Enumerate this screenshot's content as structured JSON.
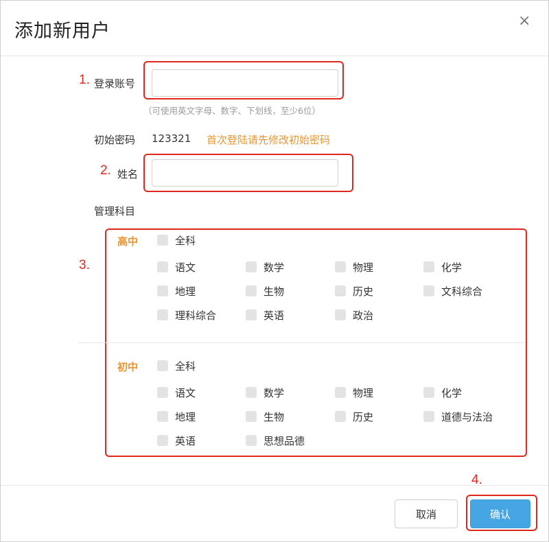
{
  "dialog": {
    "title": "添加新用户",
    "close_glyph": "×"
  },
  "annotations": [
    "1.",
    "2.",
    "3.",
    "4."
  ],
  "form": {
    "account_label": "登录账号",
    "account_value": "",
    "account_hint": "（可使用英文字母、数字、下划线，至少6位）",
    "password_label": "初始密码",
    "password_value": "123321",
    "password_warning": "首次登陆请先修改初始密码",
    "name_label": "姓名",
    "name_value": "",
    "subjects_label": "管理科目"
  },
  "subjects": {
    "high": {
      "title": "高中",
      "all": "全科",
      "items": [
        "语文",
        "数学",
        "物理",
        "化学",
        "地理",
        "生物",
        "历史",
        "文科综合",
        "理科综合",
        "英语",
        "政治"
      ]
    },
    "middle": {
      "title": "初中",
      "all": "全科",
      "items": [
        "语文",
        "数学",
        "物理",
        "化学",
        "地理",
        "生物",
        "历史",
        "道德与法治",
        "英语",
        "思想品德"
      ]
    }
  },
  "buttons": {
    "cancel": "取消",
    "confirm": "确认"
  },
  "colors": {
    "accent_orange": "#e8952e",
    "primary_blue": "#45a6e3",
    "annotation_red": "#e0271e"
  }
}
